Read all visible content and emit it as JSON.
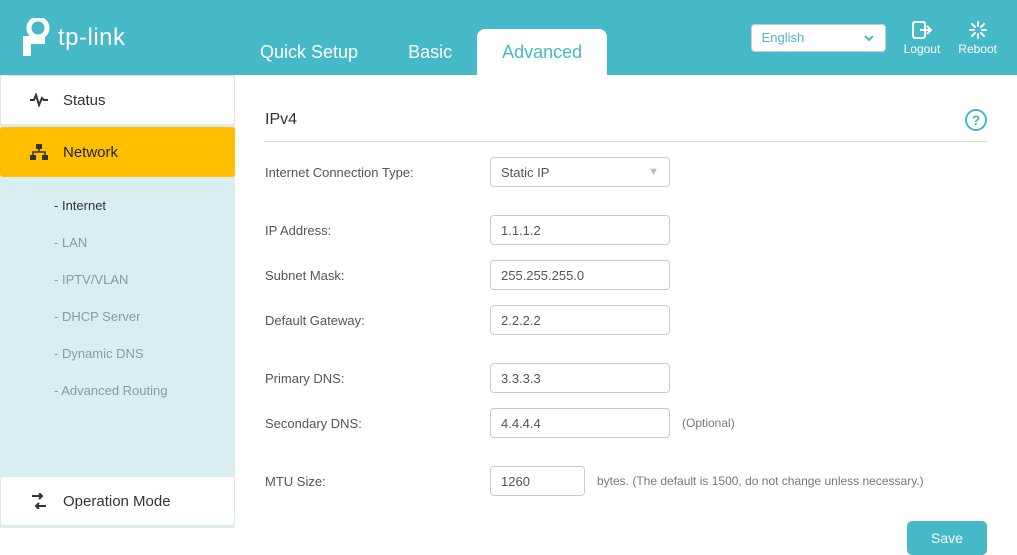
{
  "brand": "tp-link",
  "header": {
    "tabs": {
      "quick_setup": "Quick Setup",
      "basic": "Basic",
      "advanced": "Advanced"
    },
    "language": "English",
    "logout": "Logout",
    "reboot": "Reboot"
  },
  "sidebar": {
    "status": "Status",
    "network": "Network",
    "sub": {
      "internet": "Internet",
      "lan": "LAN",
      "iptv": "IPTV/VLAN",
      "dhcp": "DHCP Server",
      "ddns": "Dynamic DNS",
      "routing": "Advanced Routing"
    },
    "opmode": "Operation Mode"
  },
  "panel": {
    "title": "IPv4",
    "labels": {
      "conn_type": "Internet Connection Type:",
      "ip": "IP Address:",
      "mask": "Subnet Mask:",
      "gw": "Default Gateway:",
      "dns1": "Primary DNS:",
      "dns2": "Secondary DNS:",
      "mtu": "MTU Size:"
    },
    "values": {
      "conn_type": "Static IP",
      "ip": "1.1.1.2",
      "mask": "255.255.255.0",
      "gw": "2.2.2.2",
      "dns1": "3.3.3.3",
      "dns2": "4.4.4.4",
      "mtu": "1260"
    },
    "optional": "(Optional)",
    "mtu_hint": "bytes. (The default is 1500, do not change unless necessary.)",
    "save": "Save"
  }
}
